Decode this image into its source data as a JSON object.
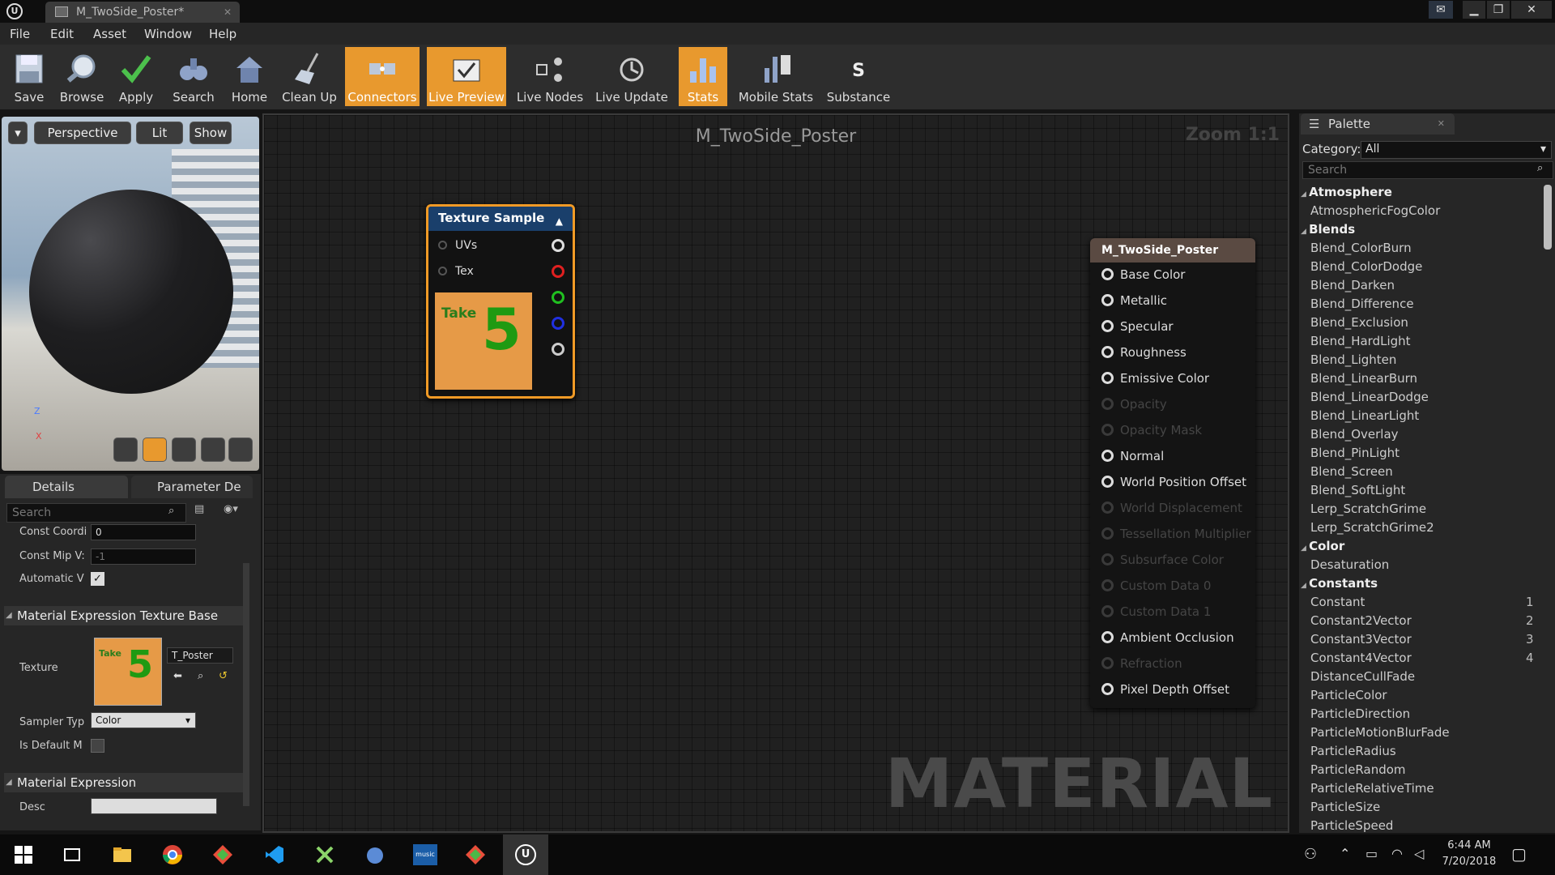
{
  "window": {
    "tab_title": "M_TwoSide_Poster*"
  },
  "menu": [
    "File",
    "Edit",
    "Asset",
    "Window",
    "Help"
  ],
  "toolbar": [
    "Save",
    "Browse",
    "Apply",
    "Search",
    "Home",
    "Clean Up",
    "Connectors",
    "Live Preview",
    "Live Nodes",
    "Live Update",
    "Stats",
    "Mobile Stats",
    "Substance"
  ],
  "viewport": {
    "perspective": "Perspective",
    "lit": "Lit",
    "show": "Show",
    "axis_z": "Z",
    "axis_x": "X"
  },
  "details": {
    "tab_details": "Details",
    "tab_params": "Parameter De",
    "search_placeholder": "Search",
    "const_coord_label": "Const Coordi",
    "const_coord_value": "0",
    "const_mip_label": "Const Mip V:",
    "const_mip_value": "-1",
    "automatic_label": "Automatic V",
    "cat_texture_base": "Material Expression Texture Base",
    "texture_label": "Texture",
    "texture_asset": "T_Poster",
    "sampler_label": "Sampler Typ",
    "sampler_value": "Color",
    "is_default_label": "Is Default M",
    "cat_expression": "Material Expression",
    "desc_label": "Desc",
    "desc_value": ""
  },
  "graph": {
    "title": "M_TwoSide_Poster",
    "zoom": "Zoom 1:1",
    "watermark": "MATERIAL",
    "texture_node": {
      "title": "Texture Sample",
      "pin_uvs": "UVs",
      "pin_tex": "Tex",
      "thumb_text_small": "Take",
      "thumb_text_big": "5"
    },
    "material_node": {
      "title": "M_TwoSide_Poster",
      "pins": [
        {
          "label": "Base Color",
          "active": true
        },
        {
          "label": "Metallic",
          "active": true
        },
        {
          "label": "Specular",
          "active": true
        },
        {
          "label": "Roughness",
          "active": true
        },
        {
          "label": "Emissive Color",
          "active": true
        },
        {
          "label": "Opacity",
          "active": false
        },
        {
          "label": "Opacity Mask",
          "active": false
        },
        {
          "label": "Normal",
          "active": true
        },
        {
          "label": "World Position Offset",
          "active": true
        },
        {
          "label": "World Displacement",
          "active": false
        },
        {
          "label": "Tessellation Multiplier",
          "active": false
        },
        {
          "label": "Subsurface Color",
          "active": false
        },
        {
          "label": "Custom Data 0",
          "active": false
        },
        {
          "label": "Custom Data 1",
          "active": false
        },
        {
          "label": "Ambient Occlusion",
          "active": true
        },
        {
          "label": "Refraction",
          "active": false
        },
        {
          "label": "Pixel Depth Offset",
          "active": true
        }
      ]
    }
  },
  "palette": {
    "tab": "Palette",
    "category_label": "Category:",
    "category_value": "All",
    "search_placeholder": "Search",
    "items": [
      {
        "label": "Atmosphere",
        "header": true
      },
      {
        "label": "AtmosphericFogColor"
      },
      {
        "label": "Blends",
        "header": true
      },
      {
        "label": "Blend_ColorBurn"
      },
      {
        "label": "Blend_ColorDodge"
      },
      {
        "label": "Blend_Darken"
      },
      {
        "label": "Blend_Difference"
      },
      {
        "label": "Blend_Exclusion"
      },
      {
        "label": "Blend_HardLight"
      },
      {
        "label": "Blend_Lighten"
      },
      {
        "label": "Blend_LinearBurn"
      },
      {
        "label": "Blend_LinearDodge"
      },
      {
        "label": "Blend_LinearLight"
      },
      {
        "label": "Blend_Overlay"
      },
      {
        "label": "Blend_PinLight"
      },
      {
        "label": "Blend_Screen"
      },
      {
        "label": "Blend_SoftLight"
      },
      {
        "label": "Lerp_ScratchGrime"
      },
      {
        "label": "Lerp_ScratchGrime2"
      },
      {
        "label": "Color",
        "header": true
      },
      {
        "label": "Desaturation"
      },
      {
        "label": "Constants",
        "header": true
      },
      {
        "label": "Constant",
        "hotkey": "1"
      },
      {
        "label": "Constant2Vector",
        "hotkey": "2"
      },
      {
        "label": "Constant3Vector",
        "hotkey": "3"
      },
      {
        "label": "Constant4Vector",
        "hotkey": "4"
      },
      {
        "label": "DistanceCullFade"
      },
      {
        "label": "ParticleColor"
      },
      {
        "label": "ParticleDirection"
      },
      {
        "label": "ParticleMotionBlurFade"
      },
      {
        "label": "ParticleRadius"
      },
      {
        "label": "ParticleRandom"
      },
      {
        "label": "ParticleRelativeTime"
      },
      {
        "label": "ParticleSize"
      },
      {
        "label": "ParticleSpeed"
      }
    ]
  },
  "taskbar": {
    "time": "6:44 AM",
    "date": "7/20/2018",
    "music_label": "music"
  }
}
